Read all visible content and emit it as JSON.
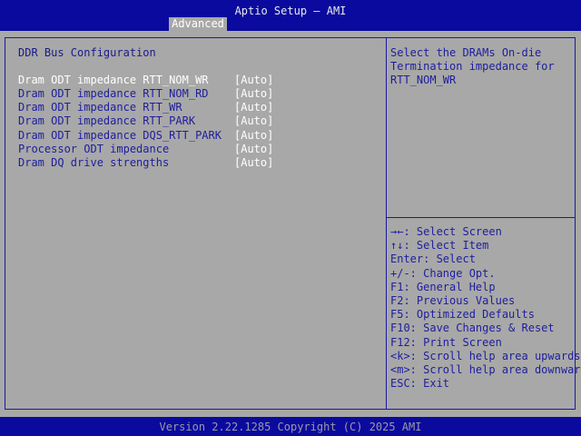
{
  "app": {
    "title": "Aptio Setup – AMI"
  },
  "tabs": [
    {
      "label": "Advanced",
      "active": true
    }
  ],
  "section": {
    "title": "DDR Bus Configuration"
  },
  "options": [
    {
      "label": "Dram ODT impedance RTT_NOM_WR",
      "value": "[Auto]",
      "selected": true
    },
    {
      "label": "Dram ODT impedance RTT_NOM_RD",
      "value": "[Auto]",
      "selected": false
    },
    {
      "label": "Dram ODT impedance RTT_WR",
      "value": "[Auto]",
      "selected": false
    },
    {
      "label": "Dram ODT impedance RTT_PARK",
      "value": "[Auto]",
      "selected": false
    },
    {
      "label": "Dram ODT impedance DQS_RTT_PARK",
      "value": "[Auto]",
      "selected": false
    },
    {
      "label": "Processor ODT impedance",
      "value": "[Auto]",
      "selected": false
    },
    {
      "label": "Dram DQ drive strengths",
      "value": "[Auto]",
      "selected": false
    }
  ],
  "help": {
    "lines": [
      "Select the DRAMs On-die",
      "Termination impedance for",
      "RTT_NOM_WR"
    ]
  },
  "keys": [
    "→←: Select Screen",
    "↑↓: Select Item",
    "Enter: Select",
    "+/-: Change Opt.",
    "F1: General Help",
    "F2: Previous Values",
    "F5: Optimized Defaults",
    "F10: Save Changes & Reset",
    "F12: Print Screen",
    "<k>: Scroll help area upwards",
    "<m>: Scroll help area downwards",
    "ESC: Exit"
  ],
  "footer": {
    "version": "Version 2.22.1285 Copyright (C) 2025 AMI"
  },
  "colors": {
    "bar": "#0a0a9e",
    "background": "#a8a8a8",
    "text": "#1e1e9e",
    "highlight": "#ffffff"
  }
}
